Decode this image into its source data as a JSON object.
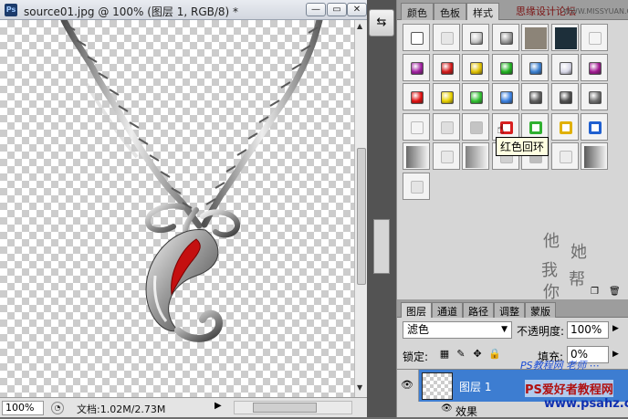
{
  "document": {
    "title": "source01.jpg @ 100% (图层 1, RGB/8) *",
    "minimize_glyph": "—",
    "restore_glyph": "▭",
    "close_glyph": "✕",
    "zoom": "100%",
    "doc_info": "文档:1.02M/2.73M"
  },
  "dock": {
    "button_glyph": "⇆"
  },
  "styles_panel": {
    "tabs": [
      "颜色",
      "色板",
      "样式"
    ],
    "tab_overlay_text": "思缘设计论坛",
    "tab_overlay_url": "WWW.MISSYUAN.COM",
    "tooltip": "红色回环",
    "swatches": [
      {
        "color": "#ffffff",
        "style": "outline"
      },
      {
        "color": "#e6e6e6",
        "style": "plain"
      },
      {
        "color": "#c8c8c8",
        "style": "bevel"
      },
      {
        "color": "#9a9a9a",
        "style": "bevel"
      },
      {
        "color": "#8c8478",
        "style": "flat"
      },
      {
        "color": "#1d2f3a",
        "style": "flat"
      },
      {
        "color": "#f4f4f4",
        "style": "plain"
      },
      {
        "color": "#a020a0",
        "style": "gem"
      },
      {
        "color": "#d01818",
        "style": "gem"
      },
      {
        "color": "#e0c000",
        "style": "gem"
      },
      {
        "color": "#20b020",
        "style": "gem"
      },
      {
        "color": "#3a7fd0",
        "style": "gem"
      },
      {
        "color": "#d8d8e8",
        "style": "gem"
      },
      {
        "color": "#a01890",
        "style": "gem"
      },
      {
        "color": "#e01010",
        "style": "gloss"
      },
      {
        "color": "#e8d000",
        "style": "gloss"
      },
      {
        "color": "#30c030",
        "style": "gloss"
      },
      {
        "color": "#3a80e0",
        "style": "gloss"
      },
      {
        "color": "#606060",
        "style": "gloss"
      },
      {
        "color": "#505050",
        "style": "gloss"
      },
      {
        "color": "#707070",
        "style": "gloss"
      },
      {
        "color": "#f4f4f4",
        "style": "plain"
      },
      {
        "color": "#dedede",
        "style": "plain"
      },
      {
        "color": "#c4c4c4",
        "style": "plain"
      },
      {
        "color": "#d82020",
        "style": "ring"
      },
      {
        "color": "#30b030",
        "style": "ring"
      },
      {
        "color": "#e0b000",
        "style": "ring"
      },
      {
        "color": "#2060d0",
        "style": "ring"
      },
      {
        "color": "#6a6a6a",
        "style": "gradient"
      },
      {
        "color": "#e8e8e8",
        "style": "plain"
      },
      {
        "color": "#808080",
        "style": "gradient"
      },
      {
        "color": "#d0d0d0",
        "style": "plain"
      },
      {
        "color": "#bdbdbd",
        "style": "plain"
      },
      {
        "color": "#ececec",
        "style": "plain"
      },
      {
        "color": "#5a5a5a",
        "style": "gradient"
      },
      {
        "color": "#e4e4e4",
        "style": "plain"
      }
    ],
    "signature_chars": [
      "他",
      "她",
      "我",
      "帮",
      "你"
    ]
  },
  "layers_panel": {
    "tabs": [
      "图层",
      "通道",
      "路径",
      "调整",
      "蒙版"
    ],
    "blend_mode": "滤色",
    "opacity_label": "不透明度:",
    "opacity": "100%",
    "lock_label": "锁定:",
    "fill_label": "填充:",
    "fill": "0%",
    "layer_name": "图层 1",
    "effects_label": "效果"
  },
  "watermarks": {
    "site_cn": "PS爱好者教程网",
    "site_url": "www.psahz.com",
    "cursive": "PS教程网 老师 ⋯"
  }
}
